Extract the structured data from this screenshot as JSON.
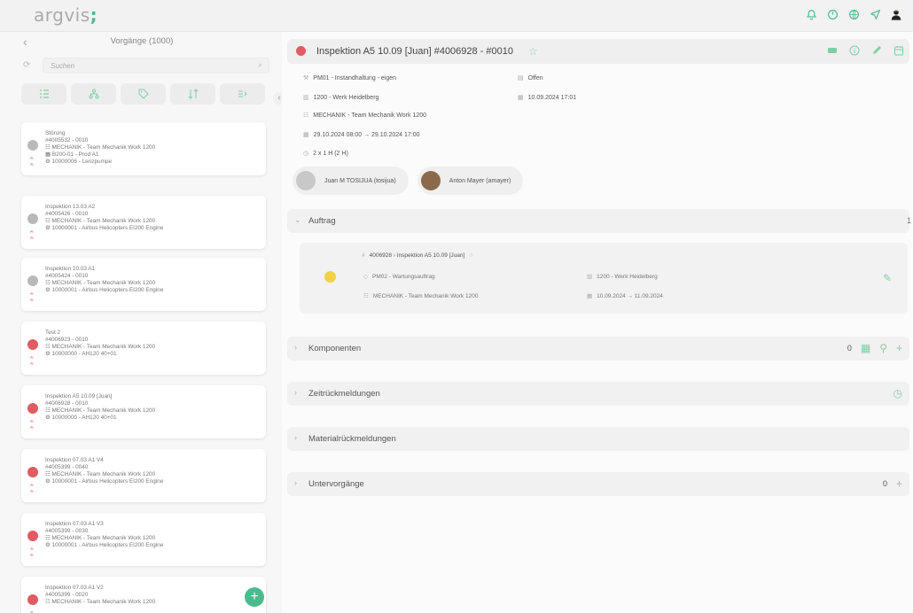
{
  "app": {
    "logo_a": "argvis",
    "logo_b": ";"
  },
  "top_icons": [
    "bell-icon",
    "power-icon",
    "network-icon",
    "send-icon",
    "user-avatar-icon"
  ],
  "list": {
    "title": "Vorgänge (1000)",
    "search_placeholder": "Suchen",
    "items": [
      {
        "status": "grey",
        "l1": "Störung",
        "l2": "#4005532 - 0010",
        "l3": "MECHANIK - Team Mechanik Work 1200",
        "l4": "B200-01 - Prod A1",
        "l5": "10000006 - Lenzpumpe"
      },
      {
        "status": "grey",
        "l1": "Inspektion 13.03 A2",
        "l2": "#4005426 - 0010",
        "l3": "MECHANIK - Team Mechanik Work 1200",
        "l4": "",
        "l5": "10000001 - Airbus Helicopters EI200 Engine"
      },
      {
        "status": "grey",
        "l1": "Inspektion 10.03 A1",
        "l2": "#4005424 - 0010",
        "l3": "MECHANIK - Team Mechanik Work 1200",
        "l4": "",
        "l5": "10000001 - Airbus Helicopters EI200 Engine"
      },
      {
        "status": "red",
        "l1": "Test 2",
        "l2": "#4006923 - 0010",
        "l3": "MECHANIK - Team Mechanik Work 1200",
        "l4": "",
        "l5": "10000000 - AH120 40+01"
      },
      {
        "status": "red",
        "l1": "Inspektion A5 10.09 [Juan]",
        "l2": "#4006928 - 0010",
        "l3": "MECHANIK - Team Mechanik Work 1200",
        "l4": "",
        "l5": "10000000 - AH120 40+01"
      },
      {
        "status": "red",
        "l1": "Inspektion 07.03 A1 V4",
        "l2": "#4005399 - 0040",
        "l3": "MECHANIK - Team Mechanik Work 1200",
        "l4": "",
        "l5": "10000001 - Airbus Helicopters EI200 Engine"
      },
      {
        "status": "red",
        "l1": "Inspektion 07.03 A1 V3",
        "l2": "#4005399 - 0030",
        "l3": "MECHANIK - Team Mechanik Work 1200",
        "l4": "",
        "l5": "10000001 - Airbus Helicopters EI200 Engine"
      },
      {
        "status": "red",
        "l1": "Inspektion 07.03 A1 V2",
        "l2": "#4005399 - 0020",
        "l3": "MECHANIK - Team Mechanik Work 1200",
        "l4": "",
        "l5": ""
      }
    ]
  },
  "detail": {
    "title": "Inspektion A5 10.09 [Juan] #4006928 - #0010",
    "type": "PM01 - Instandhaltung - eigen",
    "status": "Offen",
    "plant": "1200 - Werk Heidelberg",
    "date": "10.09.2024 17:01",
    "team": "MECHANIK - Team Mechanik Work 1200",
    "period": "29.10.2024 08:00 → 29.10.2024 17:00",
    "effort": "2 x 1 H (2 H)",
    "persons": [
      "Juan M TOSIJUA (tosijua)",
      "Anton Mayer (amayer)"
    ]
  },
  "auftrag": {
    "section_label": "Auftrag",
    "count": "1",
    "order_no": "4006928",
    "order_title": "Inspektion A5 10.09 [Juan]",
    "type": "PM02 - Wartungsauftrag",
    "plant": "1200 - Werk Heidelberg",
    "team": "MECHANIK - Team Mechanik Work 1200",
    "period": "10.09.2024 → 11.09.2024"
  },
  "sections": {
    "komponenten": {
      "label": "Komponenten",
      "count": "0"
    },
    "zeit": {
      "label": "Zeitrückmeldungen"
    },
    "material": {
      "label": "Materialrückmeldungen"
    },
    "unter": {
      "label": "Untervorgänge",
      "count": "0"
    }
  }
}
